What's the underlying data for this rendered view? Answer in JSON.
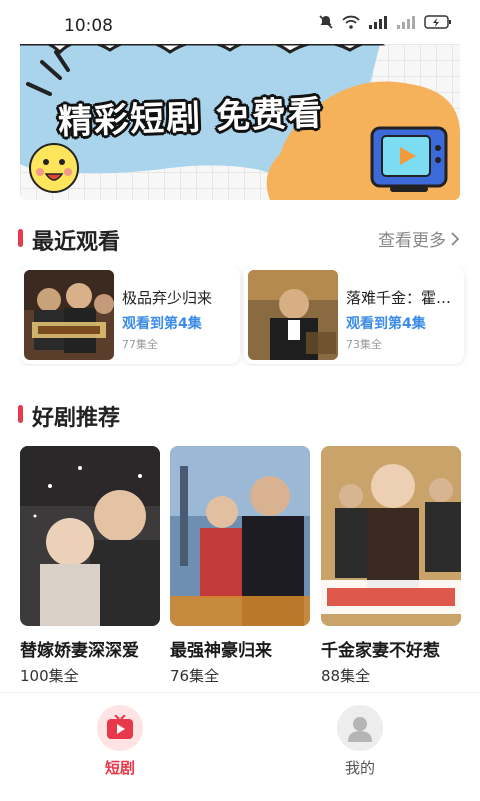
{
  "status_bar": {
    "time": "10:08"
  },
  "banner": {
    "title": "精彩短剧 免费看"
  },
  "recent": {
    "title": "最近观看",
    "more_label": "查看更多",
    "items": [
      {
        "title": "极品弃少归来",
        "progress": "观看到第4集",
        "count": "77集全"
      },
      {
        "title": "落难千金：霍…",
        "progress": "观看到第4集",
        "count": "73集全"
      }
    ]
  },
  "recommend": {
    "title": "好剧推荐",
    "items": [
      {
        "title": "替嫁娇妻深深爱",
        "eps": "100集全"
      },
      {
        "title": "最强神豪归来",
        "eps": "76集全"
      },
      {
        "title": "千金家妻不好惹",
        "eps": "88集全"
      }
    ]
  },
  "tabs": [
    {
      "label": "短剧",
      "active": true
    },
    {
      "label": "我的",
      "active": false
    }
  ],
  "colors": {
    "accent": "#e8394a",
    "link": "#3b8be8",
    "tab_active": "#e8394a",
    "tab_inactive": "#555555"
  }
}
